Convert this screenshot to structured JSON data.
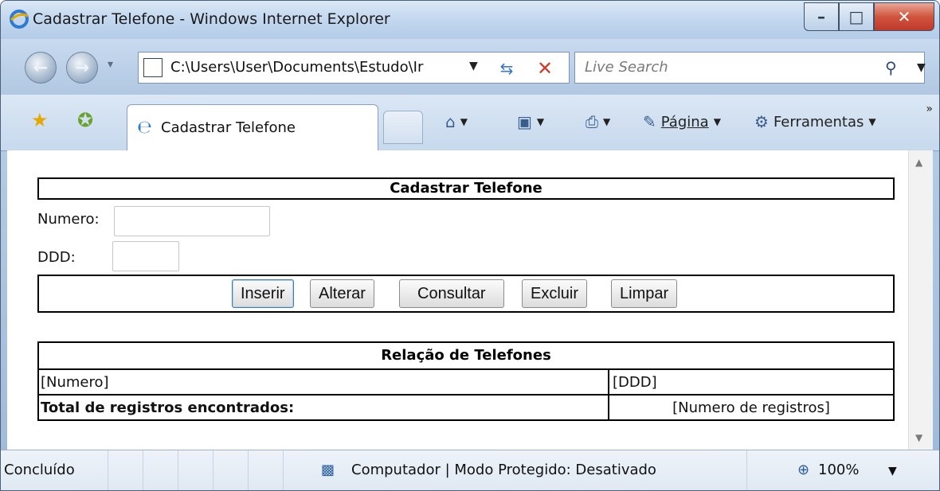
{
  "window": {
    "title": "Cadastrar Telefone - Windows Internet Explorer"
  },
  "nav": {
    "address": "C:\\Users\\User\\Documents\\Estudo\\Ir",
    "search_placeholder": "Live Search"
  },
  "tabs": {
    "active_label": "Cadastrar Telefone"
  },
  "toolbar": {
    "page_label": "Página",
    "tools_label": "Ferramentas",
    "more_label": "»"
  },
  "form": {
    "title": "Cadastrar Telefone",
    "numero_label": "Numero:",
    "ddd_label": "DDD:",
    "numero_value": "",
    "ddd_value": "",
    "buttons": {
      "inserir": "Inserir",
      "alterar": "Alterar",
      "consultar": "Consultar",
      "excluir": "Excluir",
      "limpar": "Limpar"
    }
  },
  "list": {
    "title": "Relação de Telefones",
    "col_numero": "[Numero]",
    "col_ddd": "[DDD]",
    "total_label": "Total de registros encontrados:",
    "total_value": "[Numero de registros]"
  },
  "status": {
    "left": "Concluído",
    "zone": "Computador | Modo Protegido: Desativado",
    "zoom": "100%"
  },
  "colors": {
    "close_button": "#c0392b",
    "accent": "#3c7fb1"
  }
}
